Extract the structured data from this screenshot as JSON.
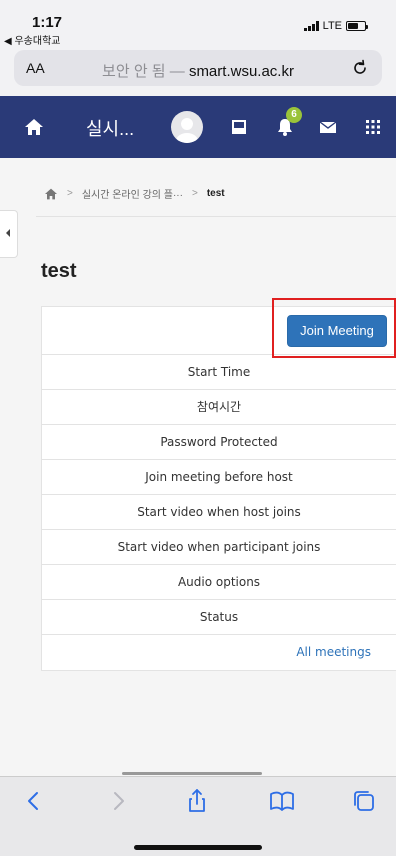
{
  "status_bar": {
    "time": "1:17",
    "back_app": "◀ 우송대학교",
    "network": "LTE"
  },
  "url_bar": {
    "text_size_label": "AA",
    "security_label": "보안 안 됨",
    "separator": "—",
    "domain": "smart.wsu.ac.kr"
  },
  "navbar": {
    "title": "실시...",
    "notification_count": "6",
    "bg_color": "#2a3a78"
  },
  "breadcrumb": {
    "items": [
      "실시간 온라인 강의 플···",
      "test"
    ]
  },
  "page": {
    "title": "test"
  },
  "meeting": {
    "join_label": "Join Meeting",
    "rows": [
      "Start Time",
      "참여시간",
      "Password Protected",
      "Join meeting before host",
      "Start video when host joins",
      "Start video when participant joins",
      "Audio options",
      "Status"
    ],
    "all_meetings_label": "All meetings"
  },
  "icons": {
    "home": "home-icon",
    "avatar": "user-avatar-icon",
    "blocks": "blocks-icon",
    "notifications": "bell-icon",
    "messages": "mail-icon",
    "apps": "grid-icon",
    "reload": "reload-icon",
    "back": "back-arrow-icon",
    "forward": "forward-arrow-icon",
    "share": "share-icon",
    "bookmarks": "book-icon",
    "tabs": "tabs-icon"
  },
  "colors": {
    "accent": "#2e73b9",
    "highlight": "#e02020",
    "badge": "#9ac33a"
  }
}
